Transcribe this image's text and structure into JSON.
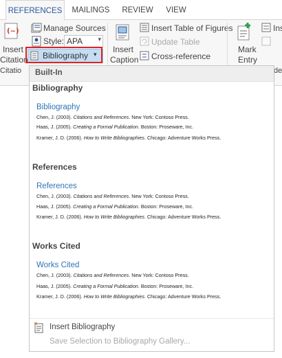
{
  "tabs": [
    "REFERENCES",
    "MAILINGS",
    "REVIEW",
    "VIEW"
  ],
  "ribbon": {
    "insert_citation_top": "Insert",
    "insert_citation_bottom": "Citation",
    "manage_sources": "Manage Sources",
    "style_label": "Style:",
    "style_value": "APA",
    "bibliography": "Bibliography",
    "group_citations": "Citatio",
    "insert_caption_top": "Insert",
    "insert_caption_bottom": "Caption",
    "insert_table_of_figures": "Insert Table of Figures",
    "update_table": "Update Table",
    "cross_reference": "Cross-reference",
    "mark_entry_top": "Mark",
    "mark_entry_bottom": "Entry",
    "insert_index_partial": "Ins",
    "index_group_partial": "de"
  },
  "gallery": {
    "header": "Built-In",
    "sections": [
      {
        "title": "Bibliography",
        "subtitle": "Bibliography",
        "entries": [
          {
            "pre": "Chen, J. (2003). ",
            "title": "Citations and References",
            "post": ". New York: Contoso Press."
          },
          {
            "pre": "Haas, J. (2005). ",
            "title": "Creating a Formal Publication",
            "post": ". Boston: Proseware, Inc."
          },
          {
            "pre": "Kramer, J. D. (2006). ",
            "title": "How to Write Bibliographies",
            "post": ". Chicago: Adventure Works Press."
          }
        ]
      },
      {
        "title": "References",
        "subtitle": "References",
        "entries": [
          {
            "pre": "Chen, J. (2003). ",
            "title": "Citations and References",
            "post": ". New York: Contoso Press."
          },
          {
            "pre": "Haas, J. (2005). ",
            "title": "Creating a Formal Publication",
            "post": ". Boston: Proseware, Inc."
          },
          {
            "pre": "Kramer, J. D. (2006). ",
            "title": "How to Write Bibliographies",
            "post": ". Chicago: Adventure Works Press."
          }
        ]
      },
      {
        "title": "Works Cited",
        "subtitle": "Works Cited",
        "entries": [
          {
            "pre": "Chen, J. (2003). ",
            "title": "Citations and References",
            "post": ". New York: Contoso Press."
          },
          {
            "pre": "Haas, J. (2005). ",
            "title": "Creating a Formal Publication",
            "post": ". Boston: Proseware, Inc."
          },
          {
            "pre": "Kramer, J. D. (2006). ",
            "title": "How to Write Bibliographies",
            "post": ". Chicago: Adventure Works Press."
          }
        ]
      }
    ],
    "insert_bibliography": "Insert Bibliography",
    "save_selection": "Save Selection to Bibliography Gallery..."
  },
  "colors": {
    "accent": "#2b579a",
    "link_blue": "#2e74b5",
    "highlight": "#c5ddf3",
    "red_outline": "#e02020",
    "icon_red": "#c0392b",
    "icon_green": "#2e9e4f"
  }
}
